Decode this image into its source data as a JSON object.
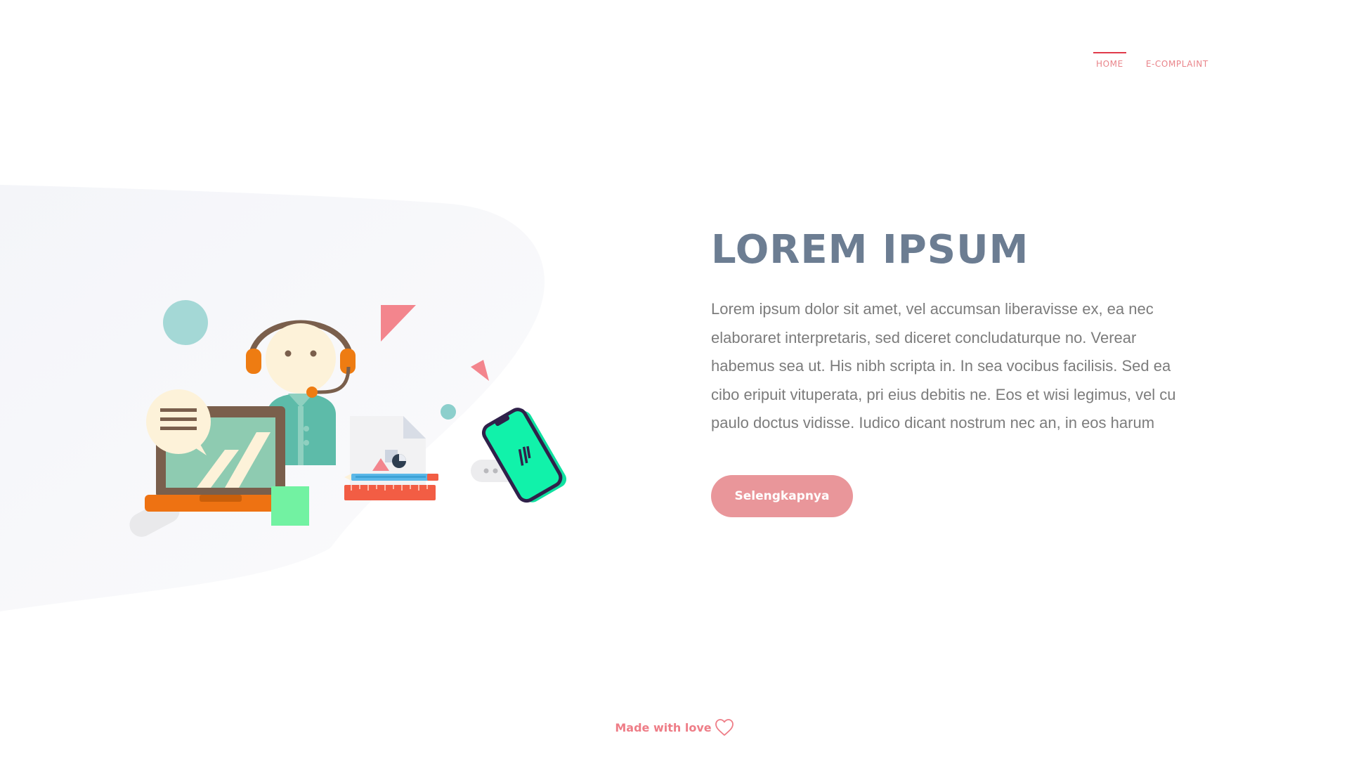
{
  "nav": {
    "items": [
      {
        "label": "HOME",
        "active": true
      },
      {
        "label": "E-COMPLAINT",
        "active": false
      }
    ]
  },
  "hero": {
    "title": "LOREM IPSUM",
    "description": "Lorem ipsum dolor sit amet, vel accumsan liberavisse ex, ea nec elaboraret interpretaris, sed diceret concludaturque no. Verear habemus sea ut. His nibh scripta in. In sea vocibus facilisis. Sed ea cibo eripuit vituperata, pri eius debitis ne. Eos et wisi legimus, vel cu paulo doctus vidisse. Iudico dicant nostrum nec an, in eos harum",
    "button_label": "Selengkapnya"
  },
  "illustration": {
    "icon": "customer-support-illustration"
  },
  "footer": {
    "text": "Made with love",
    "icon": "heart-outline-icon"
  },
  "colors": {
    "accent": "#e9848a",
    "active_underline": "#e03a4a",
    "title": "#6c7d92",
    "body_text": "#7c7c7c",
    "button": "#e9969a",
    "background_blob": "#f6f7fa"
  }
}
